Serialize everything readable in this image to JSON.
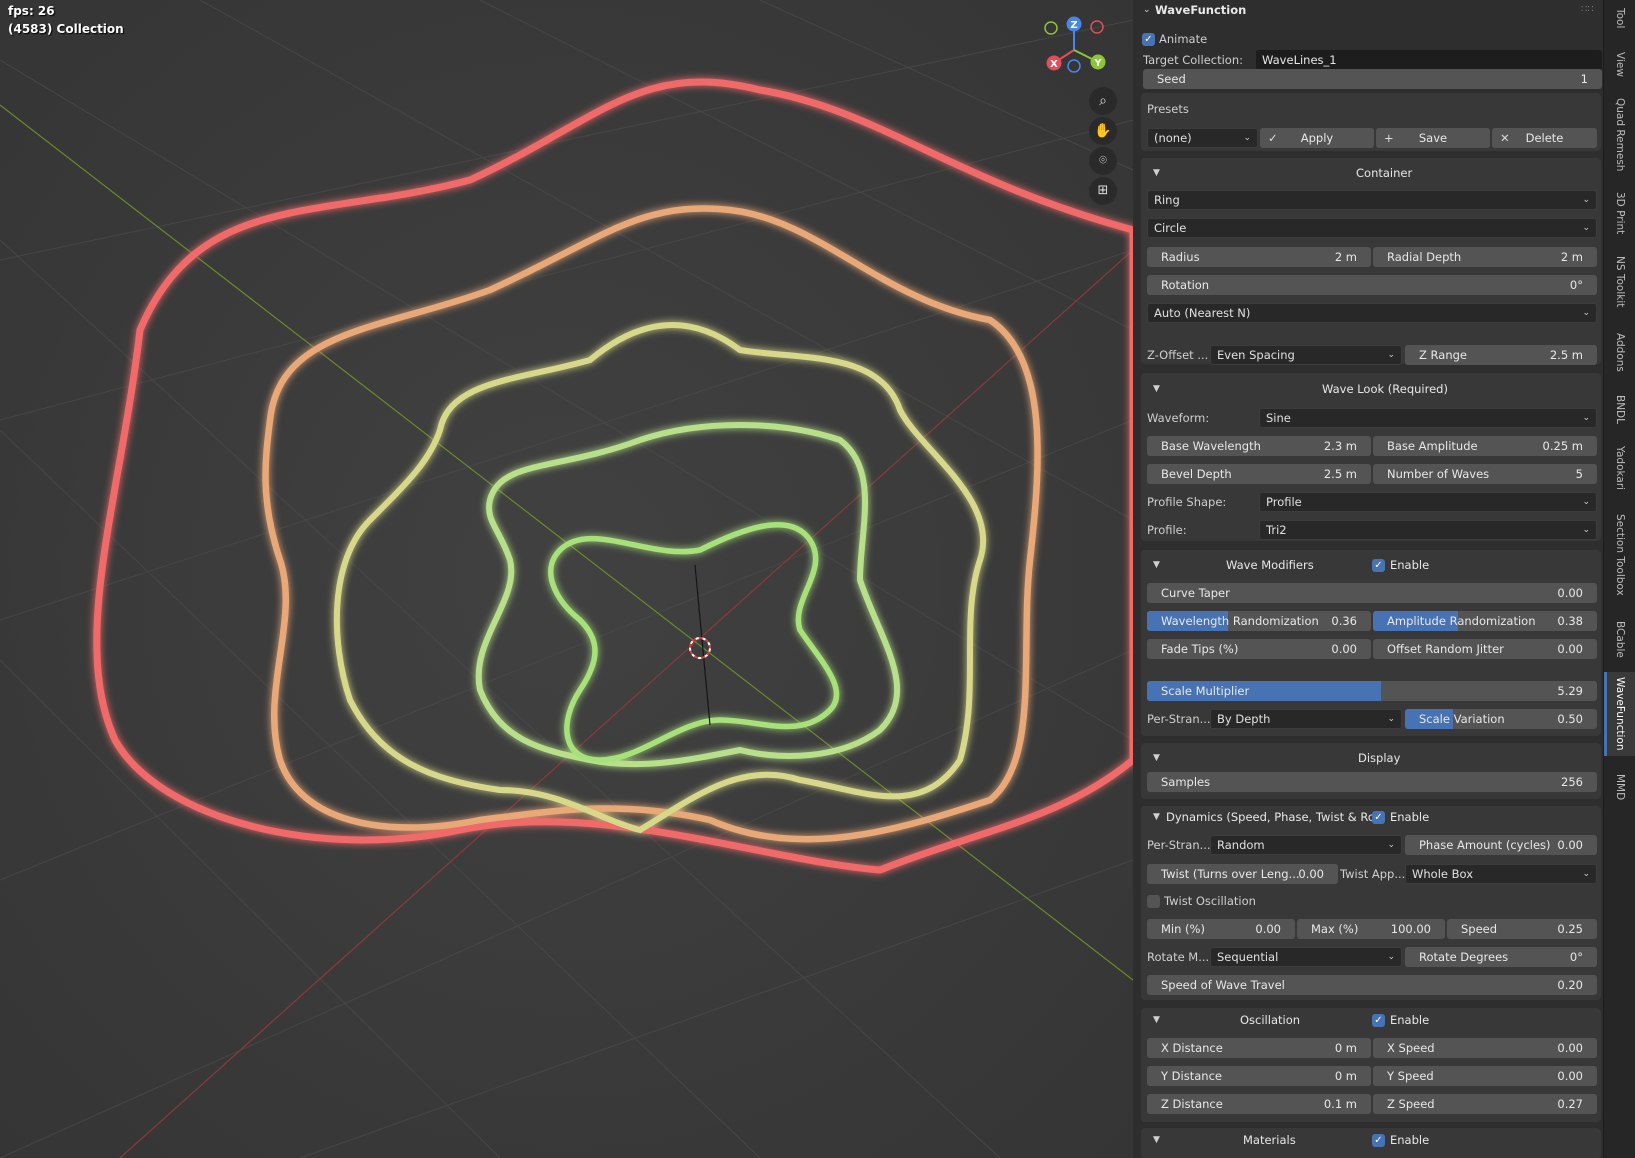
{
  "overlay": {
    "fps": "fps: 26",
    "collection": "(4583) Collection"
  },
  "gizmo": {
    "z": "Z",
    "x": "X",
    "y": "Y"
  },
  "panel": {
    "title": "WaveFunction",
    "animate": "Animate",
    "target_label": "Target Collection:",
    "target_value": "WaveLines_1",
    "seed_label": "Seed",
    "seed_value": "1",
    "presets": {
      "title": "Presets",
      "select": "(none)",
      "apply": "Apply",
      "save": "Save",
      "delete": "Delete"
    },
    "container": {
      "title": "Container",
      "shape": "Ring",
      "base": "Circle",
      "radius_label": "Radius",
      "radius": "2 m",
      "radial_depth_label": "Radial Depth",
      "radial_depth": "2 m",
      "rotation_label": "Rotation",
      "rotation": "0°",
      "auto": "Auto (Nearest N)",
      "zoffset_label": "Z-Offset ...",
      "zoffset": "Even Spacing",
      "zrange_label": "Z Range",
      "zrange": "2.5 m"
    },
    "wavelook": {
      "title": "Wave Look (Required)",
      "waveform_label": "Waveform:",
      "waveform": "Sine",
      "base_wl_label": "Base Wavelength",
      "base_wl": "2.3 m",
      "base_amp_label": "Base Amplitude",
      "base_amp": "0.25 m",
      "bevel_label": "Bevel Depth",
      "bevel": "2.5 m",
      "num_waves_label": "Number of Waves",
      "num_waves": "5",
      "profile_shape_label": "Profile Shape:",
      "profile_shape": "Profile",
      "profile_label": "Profile:",
      "profile": "Tri2"
    },
    "modifiers": {
      "title": "Wave Modifiers",
      "enable": "Enable",
      "taper_label": "Curve Taper",
      "taper": "0.00",
      "wl_rand_label": "Wavelength Randomization",
      "wl_rand": "0.36",
      "wl_rand_frac": 0.36,
      "amp_rand_label": "Amplitude Randomization",
      "amp_rand": "0.38",
      "amp_rand_frac": 0.38,
      "fade_label": "Fade Tips (%)",
      "fade": "0.00",
      "jitter_label": "Offset Random Jitter",
      "jitter": "0.00",
      "scale_mult_label": "Scale Multiplier",
      "scale_mult": "5.29",
      "scale_mult_frac": 0.52,
      "per_strand_label": "Per-Stran...",
      "per_strand": "By Depth",
      "scale_var_label": "Scale Variation",
      "scale_var": "0.50",
      "scale_var_frac": 0.25
    },
    "display": {
      "title": "Display",
      "samples_label": "Samples",
      "samples": "256"
    },
    "dynamics": {
      "title": "Dynamics (Speed, Phase, Twist & Ro...",
      "enable": "Enable",
      "per_strand_label": "Per-Stran...",
      "per_strand": "Random",
      "phase_label": "Phase Amount (cycles)",
      "phase": "0.00",
      "twist_label": "Twist (Turns over Leng...",
      "twist": "0.00",
      "twist_app_label": "Twist App...",
      "twist_app": "Whole Box",
      "twist_osc": "Twist Oscillation",
      "min_label": "Min (%)",
      "min": "0.00",
      "max_label": "Max (%)",
      "max": "100.00",
      "speed_label": "Speed",
      "speed": "0.25",
      "rotate_mode_label": "Rotate M...",
      "rotate_mode": "Sequential",
      "rotate_deg_label": "Rotate Degrees",
      "rotate_deg": "0°",
      "travel_label": "Speed of Wave Travel",
      "travel": "0.20"
    },
    "oscillation": {
      "title": "Oscillation",
      "enable": "Enable",
      "xd_label": "X Distance",
      "xd": "0 m",
      "xs_label": "X Speed",
      "xs": "0.00",
      "yd_label": "Y Distance",
      "yd": "0 m",
      "ys_label": "Y Speed",
      "ys": "0.00",
      "zd_label": "Z Distance",
      "zd": "0.1 m",
      "zs_label": "Z Speed",
      "zs": "0.27"
    },
    "materials": {
      "title": "Materials",
      "enable": "Enable"
    }
  },
  "tabs": [
    "Tool",
    "View",
    "Quad Remesh",
    "3D Print",
    "NS Toolkit",
    "Addons",
    "BNDL",
    "Yadokari",
    "Section Toolbox",
    "BCable",
    "WaveFunction",
    "MMD"
  ],
  "colors": {
    "accent": "#4772b3",
    "ring_outer": "#f06a6a",
    "ring_mid": "#e8a878",
    "ring_inner": "#a8e07a"
  }
}
